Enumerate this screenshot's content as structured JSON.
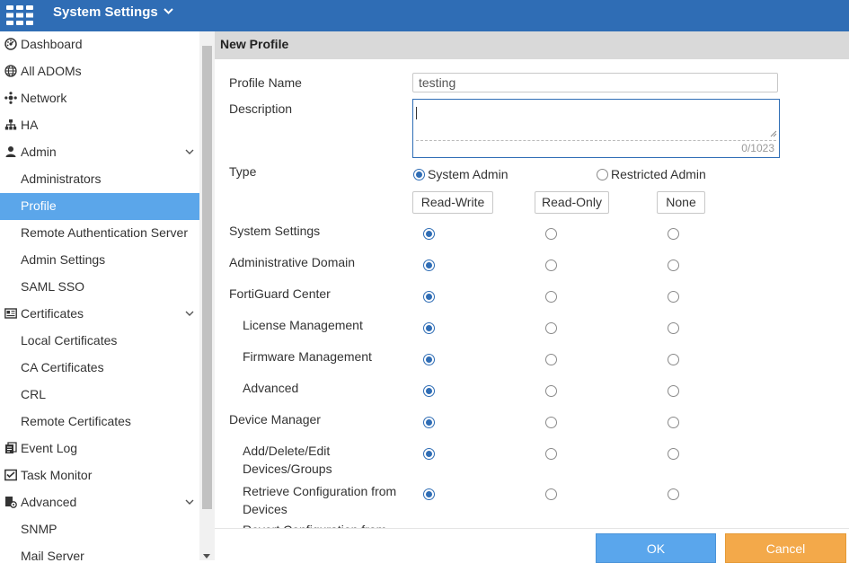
{
  "header": {
    "title": "System Settings"
  },
  "sidebar": {
    "items": [
      {
        "label": "Dashboard",
        "icon": "dashboard-icon",
        "level": 0
      },
      {
        "label": "All ADOMs",
        "icon": "globe-icon",
        "level": 0
      },
      {
        "label": "Network",
        "icon": "network-icon",
        "level": 0
      },
      {
        "label": "HA",
        "icon": "ha-icon",
        "level": 0
      },
      {
        "label": "Admin",
        "icon": "user-icon",
        "level": 0,
        "expanded": true
      },
      {
        "label": "Administrators",
        "level": 1
      },
      {
        "label": "Profile",
        "level": 1,
        "active": true
      },
      {
        "label": "Remote Authentication Server",
        "level": 1
      },
      {
        "label": "Admin Settings",
        "level": 1
      },
      {
        "label": "SAML SSO",
        "level": 1
      },
      {
        "label": "Certificates",
        "icon": "certificate-icon",
        "level": 0,
        "expanded": true
      },
      {
        "label": "Local Certificates",
        "level": 1
      },
      {
        "label": "CA Certificates",
        "level": 1
      },
      {
        "label": "CRL",
        "level": 1
      },
      {
        "label": "Remote Certificates",
        "level": 1
      },
      {
        "label": "Event Log",
        "icon": "event-log-icon",
        "level": 0
      },
      {
        "label": "Task Monitor",
        "icon": "task-monitor-icon",
        "level": 0
      },
      {
        "label": "Advanced",
        "icon": "advanced-icon",
        "level": 0,
        "expanded": true
      },
      {
        "label": "SNMP",
        "level": 1
      },
      {
        "label": "Mail Server",
        "level": 1
      }
    ]
  },
  "page": {
    "title": "New Profile"
  },
  "form": {
    "profile_name_label": "Profile Name",
    "profile_name_value": "testing",
    "description_label": "Description",
    "description_count": "0/1023",
    "type_label": "Type",
    "type_options": [
      {
        "label": "System Admin",
        "selected": true
      },
      {
        "label": "Restricted Admin",
        "selected": false
      }
    ],
    "columns": [
      "Read-Write",
      "Read-Only",
      "None"
    ],
    "permissions": [
      {
        "label": "System Settings",
        "indent": false,
        "value": "Read-Write"
      },
      {
        "label": "Administrative Domain",
        "indent": false,
        "value": "Read-Write"
      },
      {
        "label": "FortiGuard Center",
        "indent": false,
        "value": "Read-Write"
      },
      {
        "label": "License Management",
        "indent": true,
        "value": "Read-Write"
      },
      {
        "label": "Firmware Management",
        "indent": true,
        "value": "Read-Write"
      },
      {
        "label": "Advanced",
        "indent": true,
        "value": "Read-Write"
      },
      {
        "label": "Device Manager",
        "indent": false,
        "value": "Read-Write"
      },
      {
        "label": "Add/Delete/Edit Devices/Groups",
        "label_lines": [
          "Add/Delete/Edit",
          "Devices/Groups"
        ],
        "indent": true,
        "value": "Read-Write"
      },
      {
        "label": "Retrieve Configuration from Devices",
        "label_lines": [
          "Retrieve Configuration from",
          "Devices"
        ],
        "indent": true,
        "value": "Read-Write"
      }
    ],
    "cut_off_label": "Revert Configuration from"
  },
  "footer": {
    "ok_label": "OK",
    "cancel_label": "Cancel"
  },
  "colors": {
    "header_bg": "#2f6db5",
    "active_item": "#5ba6ea",
    "ok": "#5aa6ec",
    "cancel": "#f3a94a"
  }
}
